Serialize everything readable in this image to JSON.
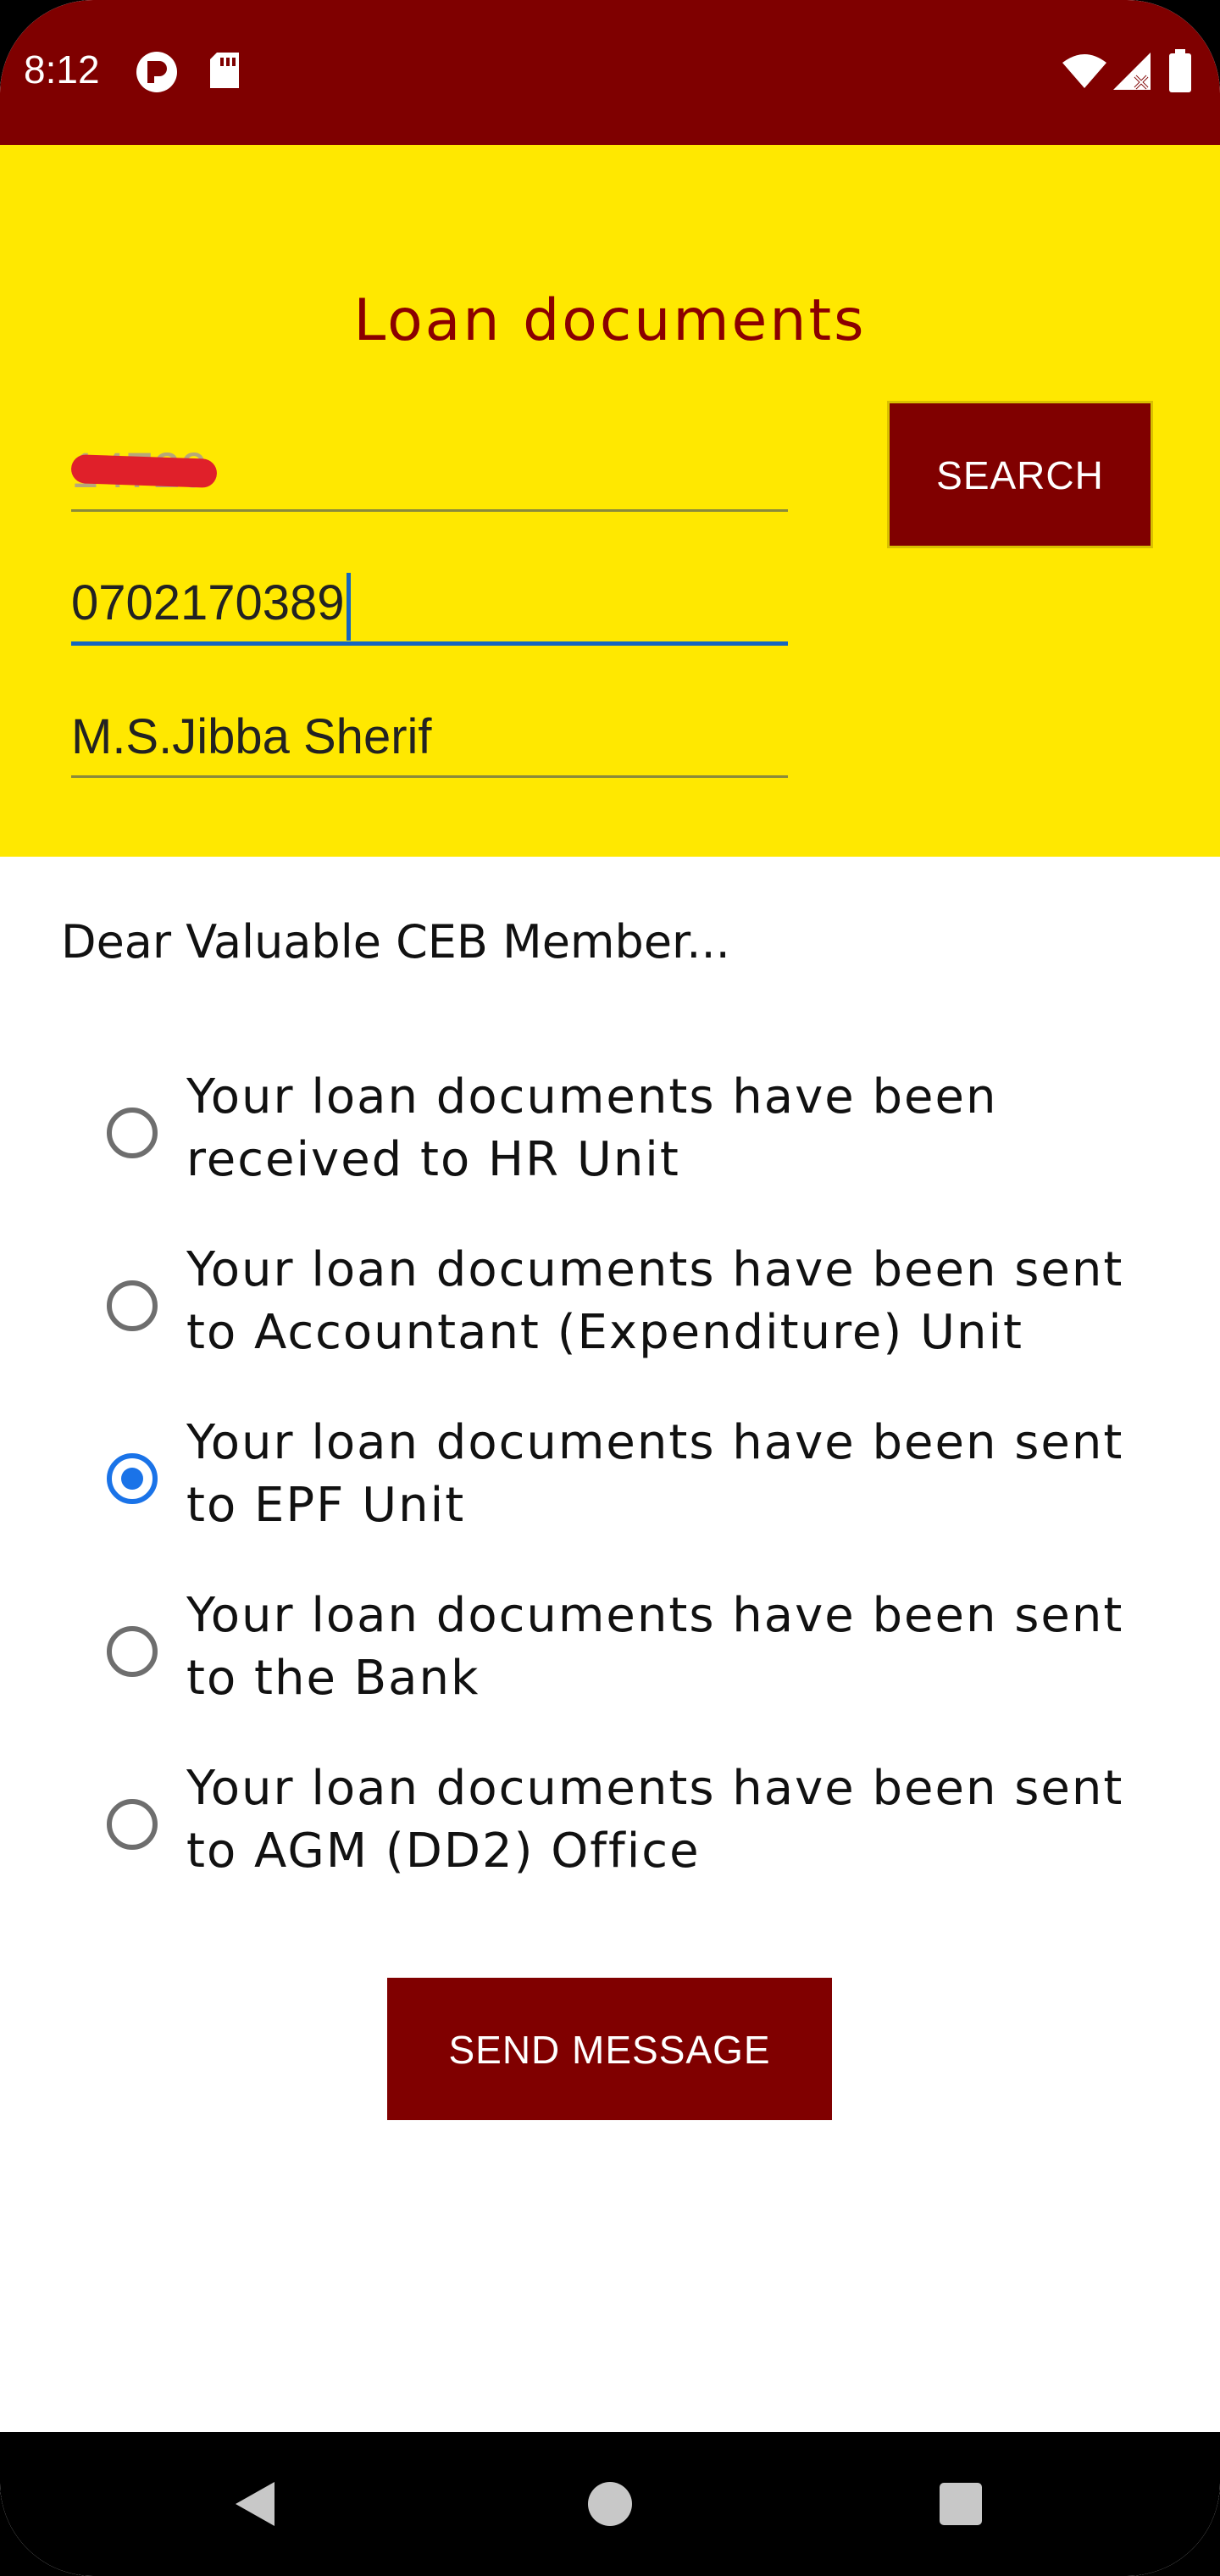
{
  "status_bar": {
    "time": "8:12",
    "left_icons": [
      "app-notification-icon",
      "sd-card-icon"
    ],
    "right_icons": [
      "wifi-icon",
      "signal-icon",
      "battery-icon"
    ]
  },
  "colors": {
    "status_bar": "#7f0000",
    "header_bg": "#ffe800",
    "title_text": "#8a0000",
    "button_bg": "#800000",
    "accent": "#1a73e8"
  },
  "header": {
    "title": "Loan documents",
    "search_label": "SEARCH",
    "fields": {
      "member_id_value": "14729",
      "phone_value": "0702170389",
      "name_value": "M.S.Jibba Sherif"
    }
  },
  "body": {
    "greeting": "Dear Valuable CEB Member...",
    "options": [
      {
        "label": "Your loan documents have been received to HR Unit",
        "checked": false
      },
      {
        "label": "Your loan documents have been sent to Accountant (Expenditure) Unit",
        "checked": false
      },
      {
        "label": "Your loan documents have been sent to EPF Unit",
        "checked": true
      },
      {
        "label": "Your loan documents have been sent to the Bank",
        "checked": false
      },
      {
        "label": "Your loan documents have been sent to AGM (DD2) Office",
        "checked": false
      }
    ],
    "send_label": "SEND MESSAGE"
  },
  "nav_bar": {
    "icons": [
      "back-icon",
      "home-icon",
      "recents-icon"
    ]
  }
}
